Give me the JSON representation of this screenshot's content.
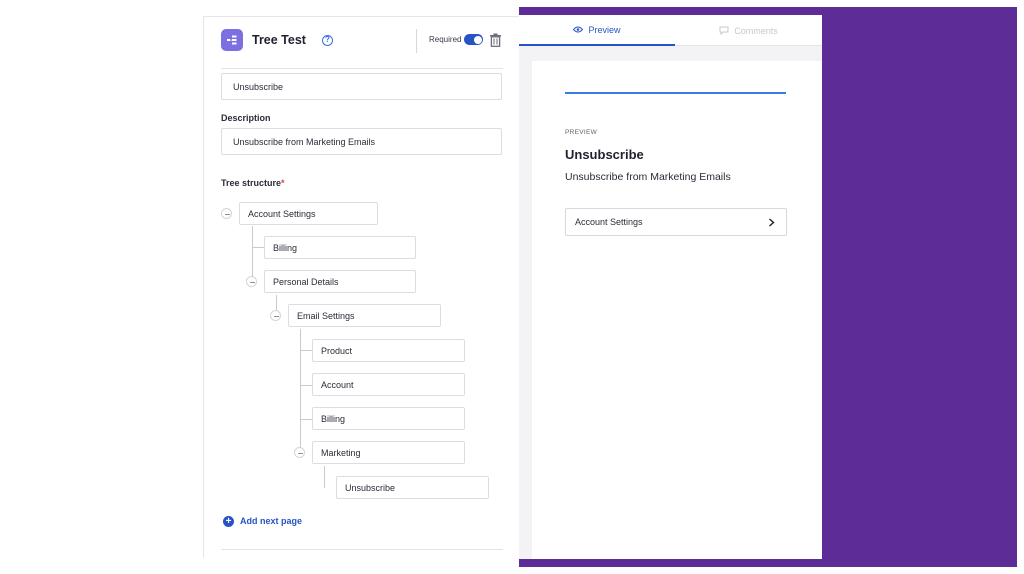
{
  "editor": {
    "title": "Tree Test",
    "required_label": "Required",
    "required_on": true,
    "question_value": "Unsubscribe",
    "description_label": "Description",
    "description_value": "Unsubscribe from Marketing Emails",
    "tree_label": "Tree structure",
    "tree_required_mark": "*",
    "tree": {
      "n1": "Account Settings",
      "n2": "Billing",
      "n3": "Personal Details",
      "n4": "Email Settings",
      "n5": "Product",
      "n6": "Account",
      "n7": "Billing",
      "n8": "Marketing",
      "n9": "Unsubscribe"
    },
    "add_page_label": "Add next page"
  },
  "preview": {
    "tab_preview": "Preview",
    "tab_comments": "Comments",
    "overline": "PREVIEW",
    "title": "Unsubscribe",
    "description": "Unsubscribe from Marketing Emails",
    "first_item": "Account Settings"
  },
  "colors": {
    "accent": "#2754c5",
    "purple_bg": "#5e2c96",
    "block_icon": "#7c6fe0"
  },
  "icons": {
    "block": "tree-block-icon",
    "help": "help-circle-icon",
    "delete": "trash-icon",
    "add": "plus-circle-icon",
    "preview_tab": "eye-icon",
    "comments_tab": "comment-bubble-icon",
    "item_arrow": "chevron-right-icon"
  }
}
